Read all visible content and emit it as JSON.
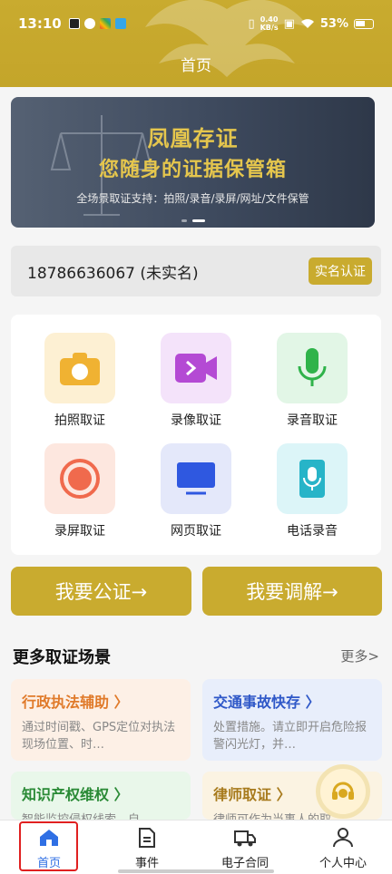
{
  "status_bar": {
    "time": "13:10",
    "speed_value": "0.40",
    "speed_unit": "KB/s",
    "battery": "53%"
  },
  "header": {
    "title": "首页"
  },
  "banner": {
    "line1": "凤凰存证",
    "line2": "您随身的证据保管箱",
    "line3": "全场景取证支持：拍照/录音/录屏/网址/文件保管"
  },
  "account": {
    "phone": "18786636067 (未实名)",
    "verify_label": "实名认证"
  },
  "tools": [
    {
      "label": "拍照取证",
      "icon": "camera-icon"
    },
    {
      "label": "录像取证",
      "icon": "video-icon"
    },
    {
      "label": "录音取证",
      "icon": "microphone-icon"
    },
    {
      "label": "录屏取证",
      "icon": "record-icon"
    },
    {
      "label": "网页取证",
      "icon": "monitor-icon"
    },
    {
      "label": "电话录音",
      "icon": "phone-record-icon"
    }
  ],
  "actions": {
    "notarize": "我要公证→",
    "mediate": "我要调解→"
  },
  "more_section": {
    "title": "更多取证场景",
    "more_label": "更多>",
    "cards": [
      {
        "title": "行政执法辅助 〉",
        "desc": "通过时间戳、GPS定位对执法现场位置、时…"
      },
      {
        "title": "交通事故快存 〉",
        "desc": "处置措施。请立即开启危险报警闪光灯，并…"
      },
      {
        "title": "知识产权维权 〉",
        "desc": "智能监控侵权线索，自"
      },
      {
        "title": "律师取证 〉",
        "desc": "律师可作为当事人的取"
      }
    ]
  },
  "tabbar": [
    {
      "label": "首页",
      "icon": "home-icon"
    },
    {
      "label": "事件",
      "icon": "document-icon"
    },
    {
      "label": "电子合同",
      "icon": "truck-icon"
    },
    {
      "label": "个人中心",
      "icon": "person-icon"
    }
  ],
  "colors": {
    "brand": "#c9ab2f",
    "active_tab": "#2f6fe4",
    "highlight": "#e02020"
  }
}
